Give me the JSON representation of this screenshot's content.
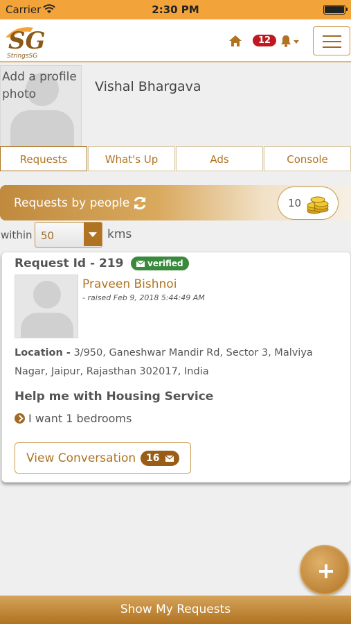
{
  "status_bar": {
    "carrier": "Carrier",
    "time": "2:30 PM"
  },
  "navbar": {
    "logo_text": "SG",
    "logo_subtitle": "StringsSG",
    "notification_count": "12"
  },
  "profile": {
    "photo_placeholder": "Add a profile photo",
    "name": "Vishal Bhargava"
  },
  "tabs": [
    {
      "label": "Requests",
      "active": true
    },
    {
      "label": "What's Up"
    },
    {
      "label": "Ads"
    },
    {
      "label": "Console"
    }
  ],
  "requests_header": {
    "title": "Requests by people",
    "coins": "10"
  },
  "filter": {
    "within_label": "within",
    "distance": "50",
    "unit_label": "kms"
  },
  "request_card": {
    "id_label": "Request Id - 219",
    "verified_label": "verified",
    "requester_name": "Praveen Bishnoi",
    "raised_on": "- raised Feb 9, 2018 5:44:49 AM",
    "location_label": "Location -",
    "location_value": "3/950, Ganeshwar Mandir Rd, Sector 3, Malviya Nagar, Jaipur, Rajasthan 302017, India",
    "help_title": "Help me with Housing Service",
    "detail": "I want 1 bedrooms",
    "view_conversation_label": "View Conversation",
    "conversation_count": "16"
  },
  "bottom_bar": {
    "label": "Show My Requests"
  },
  "colors": {
    "accent": "#b07322",
    "status_bar": "#f2a33a",
    "badge_red": "#c01820",
    "verified_green": "#3a8a3e"
  }
}
